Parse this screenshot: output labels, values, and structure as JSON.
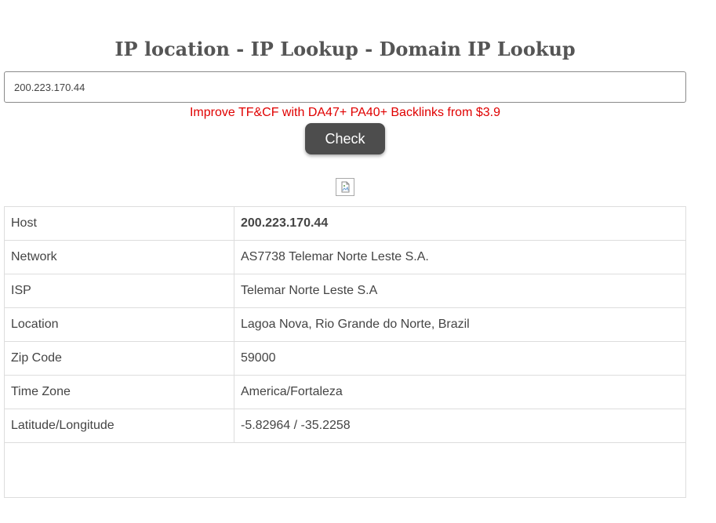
{
  "header": {
    "title": "IP location - IP Lookup - Domain IP Lookup"
  },
  "search": {
    "value": "200.223.170.44"
  },
  "promo": {
    "text": "Improve TF&CF with DA47+ PA40+ Backlinks from $3.9"
  },
  "check_button": {
    "label": "Check"
  },
  "results": {
    "rows": [
      {
        "label": "Host",
        "value": "200.223.170.44"
      },
      {
        "label": "Network",
        "value": "AS7738 Telemar Norte Leste S.A."
      },
      {
        "label": "ISP",
        "value": "Telemar Norte Leste S.A"
      },
      {
        "label": "Location",
        "value": "Lagoa Nova, Rio Grande do Norte, Brazil"
      },
      {
        "label": "Zip Code",
        "value": "59000"
      },
      {
        "label": "Time Zone",
        "value": "America/Fortaleza"
      },
      {
        "label": "Latitude/Longitude",
        "value": "-5.82964 / -35.2258"
      }
    ]
  },
  "colors": {
    "promo": "#e00000",
    "button_bg": "#4d4d4d",
    "title": "#555555"
  },
  "icons": {
    "image_placeholder": "broken-image-icon"
  }
}
